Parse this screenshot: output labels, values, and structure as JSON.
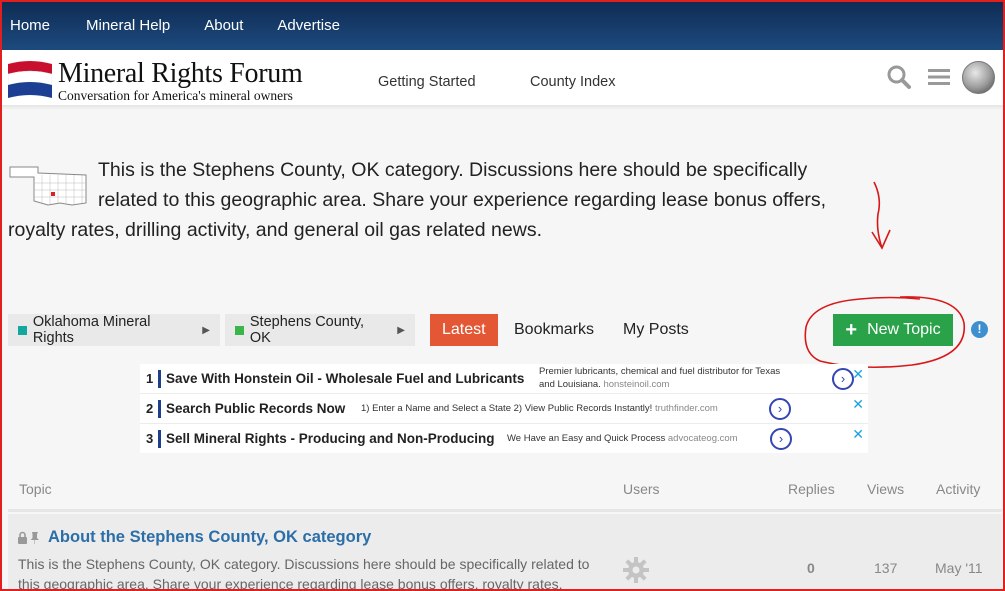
{
  "topnav": {
    "items": [
      "Home",
      "Mineral Help",
      "About",
      "Advertise"
    ]
  },
  "header": {
    "logo_title": "Mineral Rights Forum",
    "logo_tagline": "Conversation for America's mineral owners",
    "links": [
      "Getting Started",
      "County Index"
    ],
    "icons": [
      "search-icon",
      "hamburger-menu-icon",
      "user-avatar"
    ]
  },
  "description": "This is the Stephens County, OK category. Discussions here should be specifically related to this geographic area. Share your experience regarding lease bonus offers, royalty rates, drilling activity, and general oil gas related news.",
  "navbar": {
    "breadcrumb": [
      {
        "label": "Oklahoma Mineral Rights",
        "color": "#12a89d"
      },
      {
        "label": "Stephens County, OK",
        "color": "#3ab54a"
      }
    ],
    "tabs": [
      "Latest",
      "Bookmarks",
      "My Posts"
    ],
    "active_tab": "Latest",
    "new_topic_label": "New Topic",
    "colors": {
      "latest": "#e45735",
      "new_topic": "#2aa24a",
      "annotation": "#e0201e"
    }
  },
  "ads": [
    {
      "num": "1",
      "title": "Save With Honstein Oil - Wholesale Fuel and Lubricants",
      "text": "Premier lubricants, chemical and fuel distributor for Texas",
      "text2": "and Louisiana.",
      "domain": "honsteinoil.com"
    },
    {
      "num": "2",
      "title": "Search Public Records Now",
      "text": "1) Enter a Name and Select a State 2) View Public Records Instantly!",
      "domain": "truthfinder.com"
    },
    {
      "num": "3",
      "title": "Sell Mineral Rights - Producing and Non-Producing",
      "text": "We Have an Easy and Quick Process",
      "domain": "advocateog.com"
    }
  ],
  "table": {
    "headers": [
      "Topic",
      "Users",
      "Replies",
      "Views",
      "Activity"
    ],
    "rows": [
      {
        "title": "About the Stephens County, OK category",
        "excerpt": "This is the Stephens County, OK category. Discussions here should be specifically related to this geographic area. Share your experience regarding lease bonus offers, royalty rates,",
        "replies": "0",
        "views": "137",
        "activity": "May '11"
      }
    ]
  }
}
